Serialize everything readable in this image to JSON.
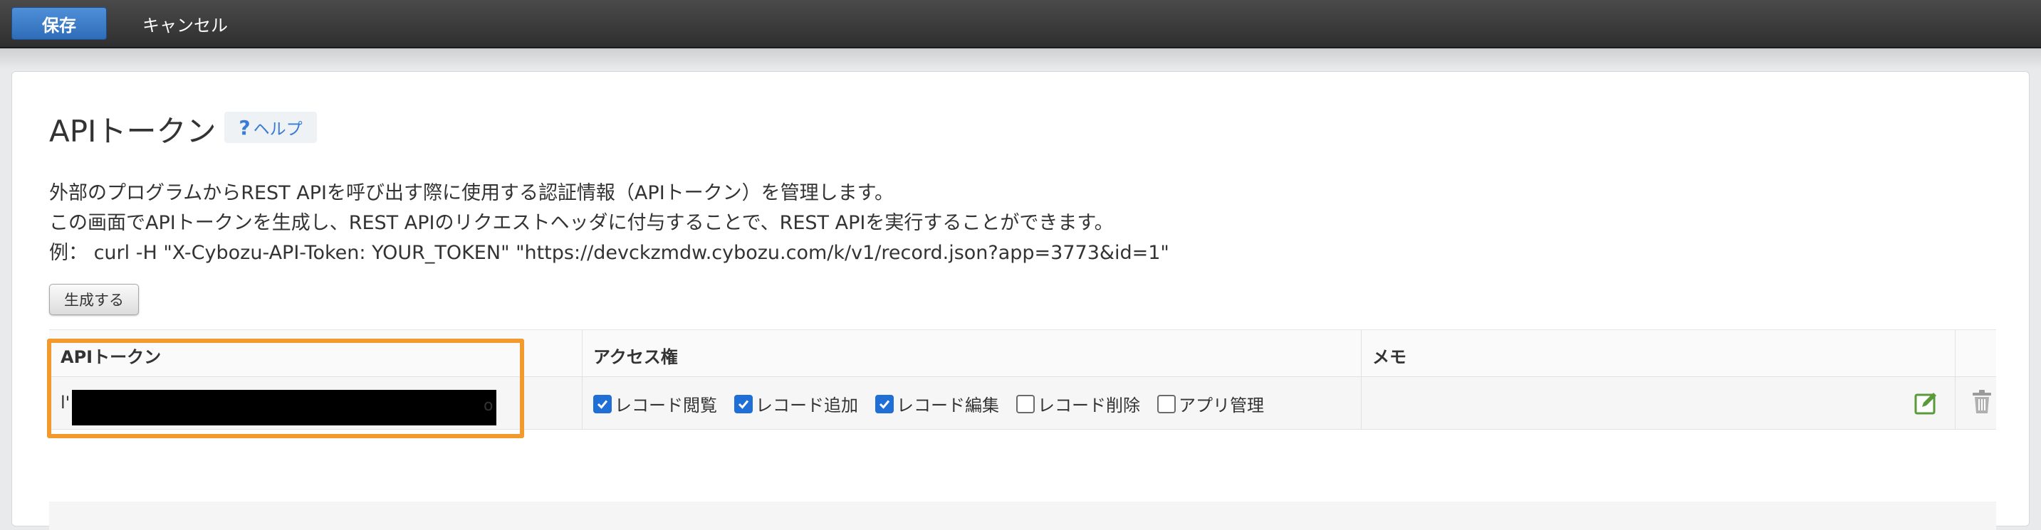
{
  "toolbar": {
    "save_label": "保存",
    "cancel_label": "キャンセル"
  },
  "header": {
    "title": "APIトークン",
    "help_icon": "?",
    "help_label": "ヘルプ"
  },
  "description": {
    "line1": "外部のプログラムからREST APIを呼び出す際に使用する認証情報（APIトークン）を管理します。",
    "line2": "この画面でAPIトークンを生成し、REST APIのリクエストヘッダに付与することで、REST APIを実行することができます。",
    "line3": "例：  curl -H \"X-Cybozu-API-Token: YOUR_TOKEN\" \"https://devckzmdw.cybozu.com/k/v1/record.json?app=3773&id=1\""
  },
  "generate_label": "生成する",
  "table": {
    "headers": {
      "token": "APIトークン",
      "access": "アクセス権",
      "memo": "メモ"
    },
    "rows": [
      {
        "token_prefix": "l'",
        "token_suffix": "o",
        "token_redacted": true,
        "permissions": [
          {
            "label": "レコード閲覧",
            "checked": true
          },
          {
            "label": "レコード追加",
            "checked": true
          },
          {
            "label": "レコード編集",
            "checked": true
          },
          {
            "label": "レコード削除",
            "checked": false
          },
          {
            "label": "アプリ管理",
            "checked": false
          }
        ],
        "memo": "",
        "edit_icon": "edit-icon",
        "delete_icon": "trash-icon"
      }
    ]
  },
  "colors": {
    "save_button": "#2e6cb8",
    "highlight": "#f39a2e",
    "checkbox_checked": "#1f6fd6",
    "edit_icon": "#5a9a3a",
    "help_text": "#3a7bd5"
  }
}
